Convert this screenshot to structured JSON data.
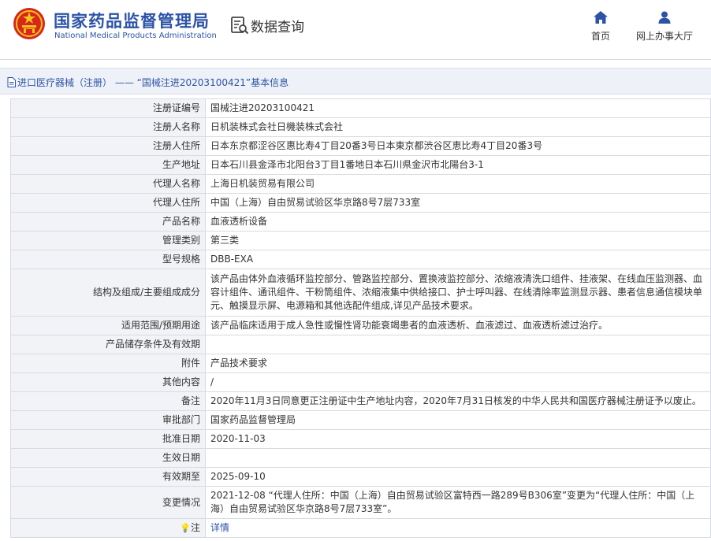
{
  "header": {
    "logo_cn": "国家药品监督管理局",
    "logo_en": "National Medical Products Administration",
    "query_label": "数据查询",
    "nav": {
      "home": "首页",
      "office": "网上办事大厅"
    }
  },
  "breadcrumb": {
    "category": "进口医疗器械（注册）",
    "separator": "——",
    "title": "“国械注进20203100421”基本信息"
  },
  "details": {
    "rows": [
      {
        "label": "注册证编号",
        "value": "国械注进20203100421"
      },
      {
        "label": "注册人名称",
        "value": "日机装株式会社日機装株式会社"
      },
      {
        "label": "注册人住所",
        "value": "日本东京都涩谷区惠比寿4丁目20番3号日本東京都渋谷区恵比寿4丁目20番3号"
      },
      {
        "label": "生产地址",
        "value": "日本石川县金泽市北阳台3丁目1番地日本石川県金沢市北陽台3-1"
      },
      {
        "label": "代理人名称",
        "value": "上海日机装贸易有限公司"
      },
      {
        "label": "代理人住所",
        "value": "中国（上海）自由贸易试验区华京路8号7层733室"
      },
      {
        "label": "产品名称",
        "value": "血液透析设备"
      },
      {
        "label": "管理类别",
        "value": "第三类"
      },
      {
        "label": "型号规格",
        "value": "DBB-EXA"
      },
      {
        "label": "结构及组成/主要组成成分",
        "value": "该产品由体外血液循环监控部分、管路监控部分、置换液监控部分、浓缩液清洗口组件、挂液架、在线血压监测器、血容计组件、通讯组件、干粉筒组件、浓缩液集中供给接口、护士呼叫器、在线清除率监测显示器、患者信息通信模块单元、触摸显示屏、电源箱和其他选配件组成,详见产品技术要求。"
      },
      {
        "label": "适用范围/预期用途",
        "value": "该产品临床适用于成人急性或慢性肾功能衰竭患者的血液透析、血液滤过、血液透析滤过治疗。"
      },
      {
        "label": "产品储存条件及有效期",
        "value": ""
      },
      {
        "label": "附件",
        "value": "产品技术要求"
      },
      {
        "label": "其他内容",
        "value": "/"
      },
      {
        "label": "备注",
        "value": "2020年11月3日同意更正注册证中生产地址内容，2020年7月31日核发的中华人民共和国医疗器械注册证予以废止。"
      },
      {
        "label": "审批部门",
        "value": "国家药品监督管理局"
      },
      {
        "label": "批准日期",
        "value": "2020-11-03"
      },
      {
        "label": "生效日期",
        "value": ""
      },
      {
        "label": "有效期至",
        "value": "2025-09-10"
      },
      {
        "label": "变更情况",
        "value": "2021-12-08 “代理人住所：中国（上海）自由贸易试验区富特西一路289号B306室”变更为“代理人住所：中国（上海）自由贸易试验区华京路8号7层733室”。"
      }
    ],
    "note": {
      "label": "注",
      "link": "详情"
    }
  }
}
